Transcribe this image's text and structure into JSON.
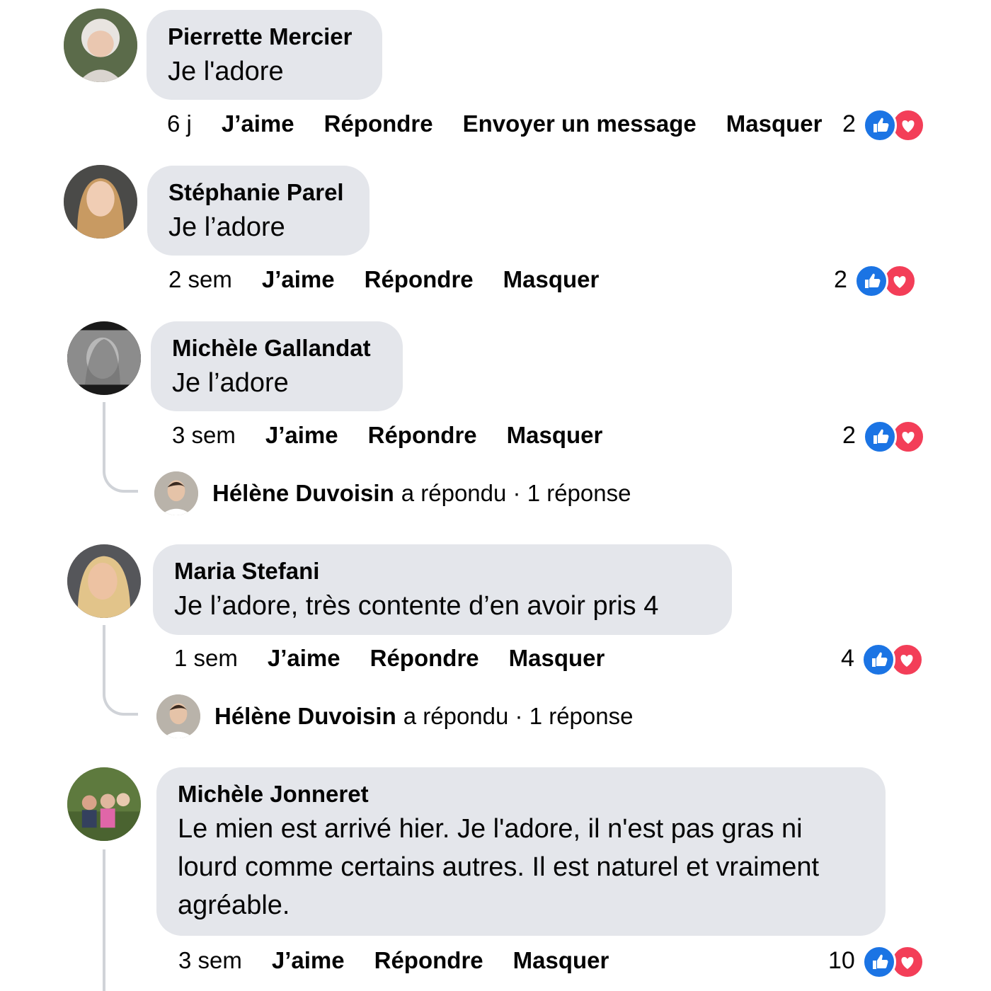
{
  "comments": [
    {
      "author": "Pierrette Mercier",
      "text": "Je l'adore",
      "time": "6 j",
      "actions": [
        "J’aime",
        "Répondre",
        "Envoyer un message",
        "Masquer"
      ],
      "reaction_count": "2"
    },
    {
      "author": "Stéphanie Parel",
      "text": "Je l’adore",
      "time": "2 sem",
      "actions": [
        "J’aime",
        "Répondre",
        "Masquer"
      ],
      "reaction_count": "2"
    },
    {
      "author": "Michèle Gallandat",
      "text": "Je l’adore",
      "time": "3 sem",
      "actions": [
        "J’aime",
        "Répondre",
        "Masquer"
      ],
      "reaction_count": "2",
      "reply": {
        "author": "Hélène Duvoisin",
        "text": "a répondu · 1 réponse"
      }
    },
    {
      "author": "Maria Stefani",
      "text": "Je l’adore, très contente d’en avoir pris 4",
      "time": "1 sem",
      "actions": [
        "J’aime",
        "Répondre",
        "Masquer"
      ],
      "reaction_count": "4",
      "reply": {
        "author": "Hélène Duvoisin",
        "text": "a répondu · 1 réponse"
      }
    },
    {
      "author": "Michèle Jonneret",
      "text": "Le mien est arrivé hier. Je l'adore, il n'est pas gras ni lourd comme certains autres. Il est naturel et vraiment agréable.",
      "time": "3 sem",
      "actions": [
        "J’aime",
        "Répondre",
        "Masquer"
      ],
      "reaction_count": "10"
    }
  ],
  "icons": {
    "like": "like-reaction-icon",
    "love": "love-reaction-icon"
  },
  "colors": {
    "bubble": "#e4e6eb",
    "like": "#1b74e4",
    "love": "#f33e58",
    "thread_line": "#d0d3d8"
  }
}
